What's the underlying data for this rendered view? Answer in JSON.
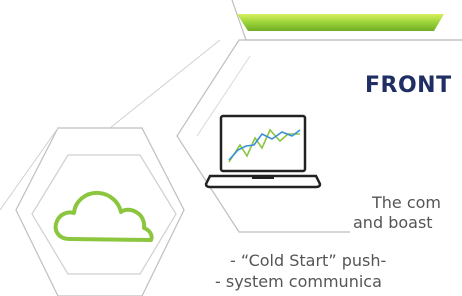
{
  "section": {
    "heading": "FRONT",
    "description_line1": "The com",
    "description_line2": "and boast"
  },
  "features": [
    "- “Cold Start” push-",
    "- system communica"
  ],
  "icons": {
    "laptop": "laptop-chart-icon",
    "cloud": "cloud-icon"
  },
  "colors": {
    "accent_green": "#8cc63f",
    "heading_navy": "#1f2e63",
    "outline_gray": "#bfbfbf",
    "chart_blue": "#3a8fd6"
  }
}
